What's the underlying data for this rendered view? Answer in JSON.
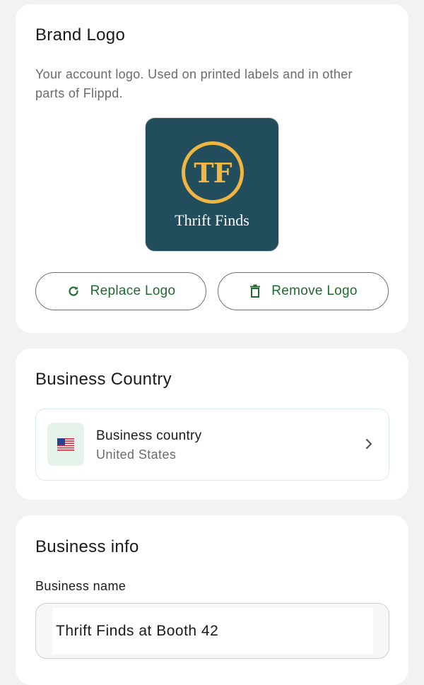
{
  "brand_logo": {
    "title": "Brand Logo",
    "description": "Your account logo. Used on printed labels and in other parts of Flippd.",
    "logo": {
      "initials": "TF",
      "name": "Thrift Finds",
      "background_color": "#214d5d",
      "accent_color": "#f1b63f"
    },
    "replace_button": {
      "label": "Replace Logo",
      "icon": "refresh-icon"
    },
    "remove_button": {
      "label": "Remove Logo",
      "icon": "trash-icon"
    }
  },
  "business_country": {
    "title": "Business Country",
    "row": {
      "label": "Business country",
      "value": "United States",
      "flag": "us-flag-icon",
      "chevron": "chevron-right-icon"
    }
  },
  "business_info": {
    "title": "Business info",
    "business_name": {
      "label": "Business name",
      "value": "Thrift Finds at Booth 42"
    }
  },
  "colors": {
    "accent_green": "#1f6a2e",
    "background": "#f2f2f2",
    "card": "#ffffff"
  }
}
